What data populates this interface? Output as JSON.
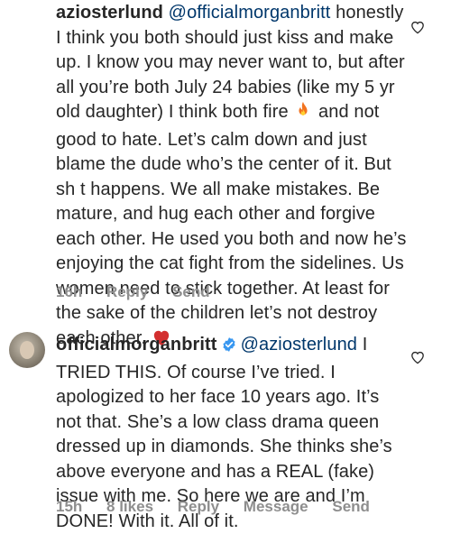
{
  "comments": [
    {
      "username": "aziosterlund",
      "mention": "@officialmorganbritt",
      "text_part1": " honestly I think you both should just kiss and make up. I know you may never want to, but after all you’re both July 24 babies (like my 5 yr old daughter) I think both fire ",
      "text_part2": " and not good to hate. Let’s calm down and just blame the dude who’s the center of it. But sh t happens. We all make mistakes. Be mature, and hug each other and forgive each other. He used you both and now he’s enjoying the cat fight from the sidelines. Us women need to stick together. At least for the sake of the children let’s not destroy each other. ",
      "emoji_1": "fire-emoji",
      "emoji_2": "red-heart-emoji",
      "time": "16h",
      "reply_label": "Reply",
      "send_label": "Send"
    },
    {
      "username": "officialmorganbritt",
      "verified": true,
      "mention": "@aziosterlund",
      "text": " I TRIED THIS. Of course I’ve tried. I apologized to her face 10 years ago. It’s not that. She’s a low class drama queen dressed up in diamonds. She thinks she’s above everyone and has a REAL (fake) issue with me. So here we are and I’m DONE! With it. All of it.",
      "time": "15h",
      "likes": "8 likes",
      "reply_label": "Reply",
      "message_label": "Message",
      "send_label": "Send"
    }
  ],
  "icons": {
    "like": "heart-outline-icon",
    "verified": "verified-badge-icon"
  },
  "colors": {
    "text": "#262626",
    "meta": "#8e8e8e",
    "mention": "#00376b",
    "verified": "#3897f0",
    "heart_emoji": "#d32f2f"
  }
}
